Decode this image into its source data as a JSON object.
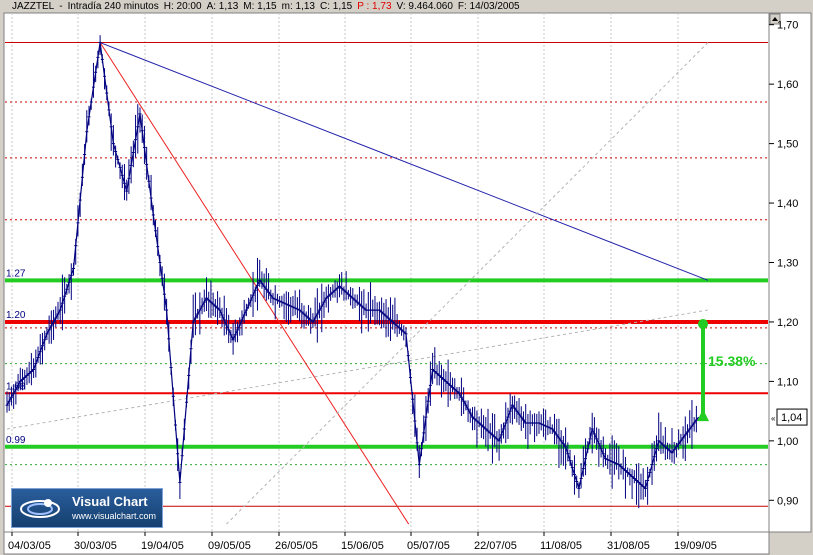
{
  "header": {
    "symbol": "JAZZTEL",
    "interval": "Intradía 240 minutos",
    "h": "H: 20:00",
    "a": "A: 1,13",
    "m": "M: 1,15",
    "mm": "m: 1,13",
    "c": "C: 1,15",
    "p": "P : 1,73",
    "v": "V: 9.464.060",
    "f": "F: 14/03/2005"
  },
  "colors": {
    "plot_bg": "#ffffff",
    "candles": "#000080",
    "support": "#22cc22",
    "resistance": "#ee0000",
    "level_dotted_red": "#cc0000",
    "level_dotted_green": "#33aa33",
    "blue_trend": "#2222aa",
    "red_trend": "#ee2222",
    "gray_trend": "#b4b4b4"
  },
  "chart_data": {
    "type": "line",
    "title": "JAZZTEL - Intradía 240 minutos",
    "x_dates": [
      "04/03/05",
      "30/03/05",
      "19/04/05",
      "09/05/05",
      "26/05/05",
      "15/06/05",
      "05/07/05",
      "22/07/05",
      "11/08/05",
      "31/08/05",
      "19/09/05"
    ],
    "y_ticks": [
      "1,70",
      "1,60",
      "1,50",
      "1,40",
      "1,30",
      "1,20",
      "1,10",
      "1,00",
      "0,90"
    ],
    "ylim": [
      0.86,
      1.71
    ],
    "series": [
      {
        "values": [
          [
            0,
            1.06
          ],
          [
            1,
            1.1
          ],
          [
            2,
            1.12
          ],
          [
            3,
            1.18
          ],
          [
            4,
            1.22
          ],
          [
            5,
            1.29
          ],
          [
            6,
            1.52
          ],
          [
            7,
            1.67
          ],
          [
            8,
            1.5
          ],
          [
            9,
            1.42
          ],
          [
            10,
            1.55
          ],
          [
            11,
            1.38
          ],
          [
            12,
            1.22
          ],
          [
            13,
            0.93
          ],
          [
            14,
            1.2
          ],
          [
            15,
            1.24
          ],
          [
            16,
            1.22
          ],
          [
            17,
            1.17
          ],
          [
            18,
            1.22
          ],
          [
            19,
            1.27
          ],
          [
            20,
            1.24
          ],
          [
            21,
            1.23
          ],
          [
            22,
            1.22
          ],
          [
            23,
            1.2
          ],
          [
            24,
            1.24
          ],
          [
            25,
            1.26
          ],
          [
            26,
            1.24
          ],
          [
            27,
            1.22
          ],
          [
            28,
            1.22
          ],
          [
            29,
            1.2
          ],
          [
            30,
            1.18
          ],
          [
            31,
            0.96
          ],
          [
            32,
            1.12
          ],
          [
            33,
            1.1
          ],
          [
            34,
            1.08
          ],
          [
            35,
            1.04
          ],
          [
            36,
            1.02
          ],
          [
            37,
            1.0
          ],
          [
            38,
            1.06
          ],
          [
            39,
            1.03
          ],
          [
            40,
            1.03
          ],
          [
            41,
            1.02
          ],
          [
            42,
            0.99
          ],
          [
            43,
            0.92
          ],
          [
            44,
            1.02
          ],
          [
            45,
            0.97
          ],
          [
            46,
            0.96
          ],
          [
            47,
            0.94
          ],
          [
            48,
            0.92
          ],
          [
            49,
            1.0
          ],
          [
            50,
            0.98
          ],
          [
            51,
            1.01
          ],
          [
            52,
            1.04
          ]
        ]
      }
    ],
    "horizontal_levels": [
      {
        "value": 1.27,
        "style": "support",
        "label": "1.27"
      },
      {
        "value": 1.2,
        "style": "resistance",
        "label": "1.20"
      },
      {
        "value": 1.08,
        "style": "resistance",
        "label": "1.08"
      },
      {
        "value": 0.99,
        "style": "support",
        "label": "0.99"
      },
      {
        "value": 1.67,
        "style": "thin_red"
      },
      {
        "value": 0.89,
        "style": "thin_red"
      },
      {
        "value": 1.57,
        "style": "dotted_red"
      },
      {
        "value": 1.476,
        "style": "dotted_red"
      },
      {
        "value": 1.372,
        "style": "dotted_red"
      },
      {
        "value": 1.19,
        "style": "dotted_red"
      },
      {
        "value": 1.13,
        "style": "dotted_green"
      },
      {
        "value": 0.96,
        "style": "dotted_green"
      }
    ],
    "trend_lines": [
      {
        "from": [
          7,
          1.67
        ],
        "to": [
          52.7,
          1.27
        ],
        "style": "blue_trend"
      },
      {
        "from": [
          7,
          1.67
        ],
        "to": [
          30.2,
          0.86
        ],
        "style": "red_trend"
      },
      {
        "from": [
          0,
          1.02
        ],
        "to": [
          52.7,
          1.22
        ],
        "style": "gray_trend"
      },
      {
        "from": [
          16.5,
          0.86
        ],
        "to": [
          52.7,
          1.67
        ],
        "style": "gray_trend"
      }
    ],
    "target": {
      "from": 1.04,
      "to": 1.2,
      "label": "15.38%"
    },
    "last_value": "1,04",
    "grid": "vertical dotted at date ticks"
  },
  "logo": {
    "name": "Visual Chart",
    "url": "www.visualchart.com"
  }
}
